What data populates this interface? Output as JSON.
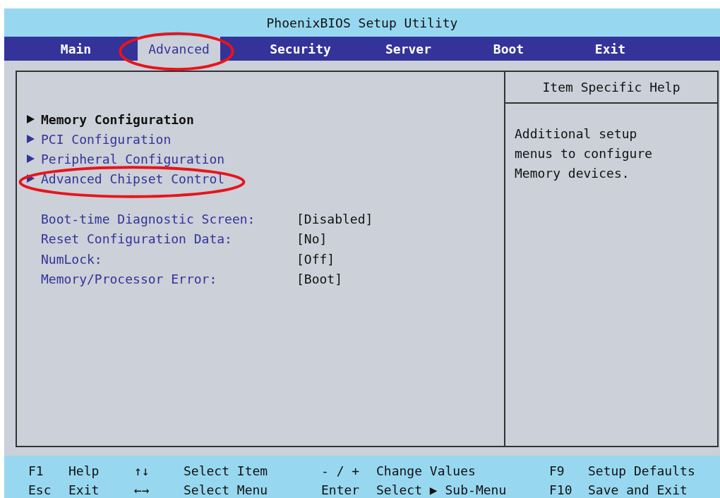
{
  "window": {
    "title": "PhoenixBIOS Setup Utility"
  },
  "tabs": [
    {
      "label": "Main",
      "selected": false,
      "circled": false
    },
    {
      "label": "Advanced",
      "selected": true,
      "circled": true
    },
    {
      "label": "Security",
      "selected": false,
      "circled": false
    },
    {
      "label": "Server",
      "selected": false,
      "circled": false
    },
    {
      "label": "Boot",
      "selected": false,
      "circled": false
    },
    {
      "label": "Exit",
      "selected": false,
      "circled": false
    }
  ],
  "submenus": [
    {
      "label": "Memory Configuration",
      "selected": true,
      "circled": false
    },
    {
      "label": "PCI Configuration",
      "selected": false,
      "circled": false
    },
    {
      "label": "Peripheral Configuration",
      "selected": false,
      "circled": false
    },
    {
      "label": "Advanced Chipset Control",
      "selected": false,
      "circled": true
    }
  ],
  "settings": [
    {
      "label": "Boot-time Diagnostic Screen:",
      "value": "[Disabled]"
    },
    {
      "label": "Reset Configuration Data:",
      "value": "[No]"
    },
    {
      "label": "NumLock:",
      "value": "[Off]"
    },
    {
      "label": "Memory/Processor Error:",
      "value": "[Boot]"
    }
  ],
  "help": {
    "title": "Item Specific Help",
    "text": "Additional setup menus to configure Memory devices."
  },
  "status_bar": [
    {
      "key": "F1",
      "action": "Help"
    },
    {
      "key": "↑↓",
      "action": "Select Item"
    },
    {
      "key": "- / +",
      "action": "Change Values"
    },
    {
      "key": "F9",
      "action": "Setup Defaults"
    },
    {
      "key": "Esc",
      "action": "Exit"
    },
    {
      "key": "←→",
      "action": "Select Menu"
    },
    {
      "key": "Enter",
      "action": "Select ▶ Sub-Menu"
    },
    {
      "key": "F10",
      "action": "Save and Exit"
    }
  ]
}
